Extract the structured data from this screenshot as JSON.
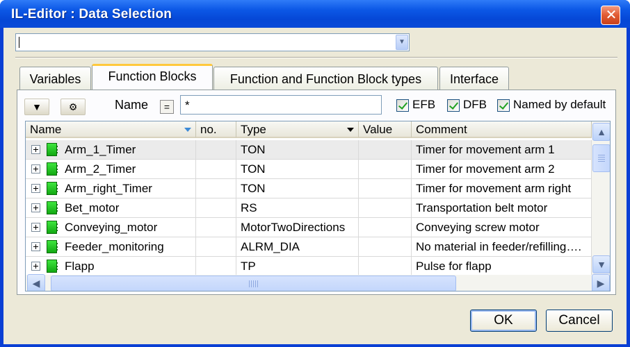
{
  "window": {
    "title": "IL-Editor : Data Selection"
  },
  "combo": {
    "value": ""
  },
  "tabs": [
    {
      "label": "Variables",
      "active": false
    },
    {
      "label": "Function Blocks",
      "active": true
    },
    {
      "label": "Function and Function Block types",
      "active": false
    },
    {
      "label": "Interface",
      "active": false
    }
  ],
  "filter": {
    "name_label": "Name",
    "eq_symbol": "=",
    "name_value": "*",
    "efb_label": "EFB",
    "dfb_label": "DFB",
    "named_by_default_label": "Named by default"
  },
  "grid": {
    "columns": [
      "Name",
      "no.",
      "Type",
      "Value",
      "Comment"
    ],
    "rows": [
      {
        "name": "Arm_1_Timer",
        "no": "",
        "type": "TON",
        "value": "",
        "comment": "Timer for movement arm 1"
      },
      {
        "name": "Arm_2_Timer",
        "no": "",
        "type": "TON",
        "value": "",
        "comment": "Timer for movement arm 2"
      },
      {
        "name": "Arm_right_Timer",
        "no": "",
        "type": "TON",
        "value": "",
        "comment": "Timer for movement arm right"
      },
      {
        "name": "Bet_motor",
        "no": "",
        "type": "RS",
        "value": "",
        "comment": "Transportation belt motor"
      },
      {
        "name": "Conveying_motor",
        "no": "",
        "type": "MotorTwoDirections",
        "value": "",
        "comment": "Conveying screw motor"
      },
      {
        "name": "Feeder_monitoring",
        "no": "",
        "type": "ALRM_DIA",
        "value": "",
        "comment": "No material in feeder/refilling…."
      },
      {
        "name": "Flapp",
        "no": "",
        "type": "TP",
        "value": "",
        "comment": "Pulse for flapp"
      }
    ]
  },
  "buttons": {
    "ok": "OK",
    "cancel": "Cancel"
  },
  "icons": {
    "close": "close-icon",
    "filter": "funnel-icon",
    "settings": "gear-icon",
    "function_block": "function-block-icon"
  }
}
